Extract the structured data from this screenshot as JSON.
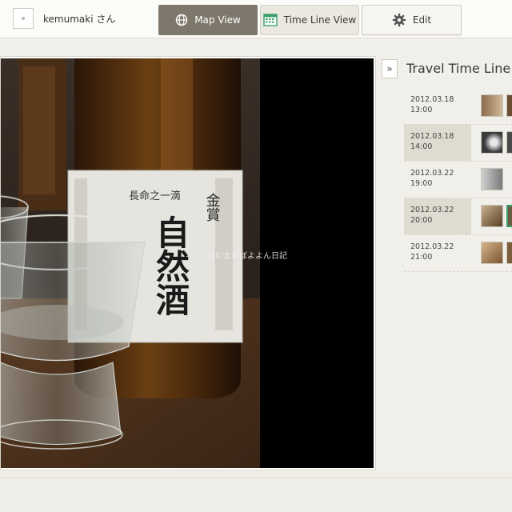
{
  "header": {
    "username": "kemumaki さん",
    "tabs": {
      "map_view": "Map View",
      "time_line_view": "Time Line View",
      "edit": "Edit"
    }
  },
  "photo": {
    "watermark": "けむ太のぼよよん日記",
    "label_top": "長命之一滴",
    "label_brand": "金賞",
    "label_main": "自然酒"
  },
  "sidebar": {
    "collapse_label": "»",
    "title": "Travel Time Line",
    "entries": [
      {
        "date": "2012.03.18",
        "time": "13:00"
      },
      {
        "date": "2012.03.18",
        "time": "14:00"
      },
      {
        "date": "2012.03.22",
        "time": "19:00"
      },
      {
        "date": "2012.03.22",
        "time": "20:00"
      },
      {
        "date": "2012.03.22",
        "time": "21:00"
      }
    ]
  },
  "colors": {
    "active_tab": "#7e776b",
    "selected_thumb": "#3aa16b",
    "background": "#f1efe9"
  }
}
